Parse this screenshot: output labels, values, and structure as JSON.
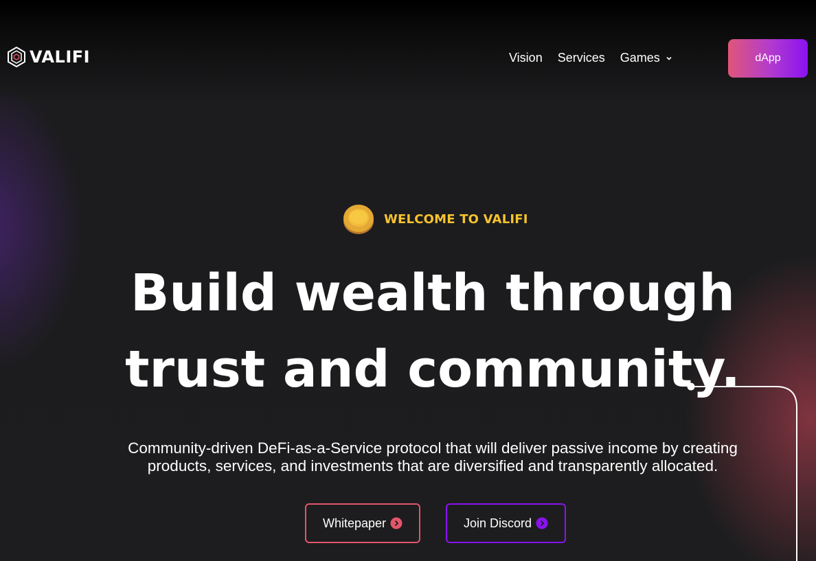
{
  "brand": {
    "name": "VALIFI"
  },
  "nav": {
    "items": [
      {
        "label": "Vision"
      },
      {
        "label": "Services"
      },
      {
        "label": "Games"
      }
    ],
    "cta_label": "dApp"
  },
  "hero": {
    "eyebrow": "WELCOME TO VALIFI",
    "headline_line1": "Build wealth through",
    "headline_line2": "trust and community.",
    "subtitle": "Community-driven DeFi-as-a-Service protocol that will deliver passive income by creating products, services, and investments that are diversified and transparently allocated.",
    "buttons": [
      {
        "label": "Whitepaper",
        "icon": "chevron-right-circle-icon",
        "accent": "#e2566a"
      },
      {
        "label": "Join Discord",
        "icon": "chevron-right-circle-icon",
        "accent": "#8a12f0"
      }
    ]
  },
  "colors": {
    "eyebrow": "#f7c32e",
    "cta_gradient_start": "#e0567a",
    "cta_gradient_end": "#8a12f0",
    "background": "#1d1d1f"
  }
}
